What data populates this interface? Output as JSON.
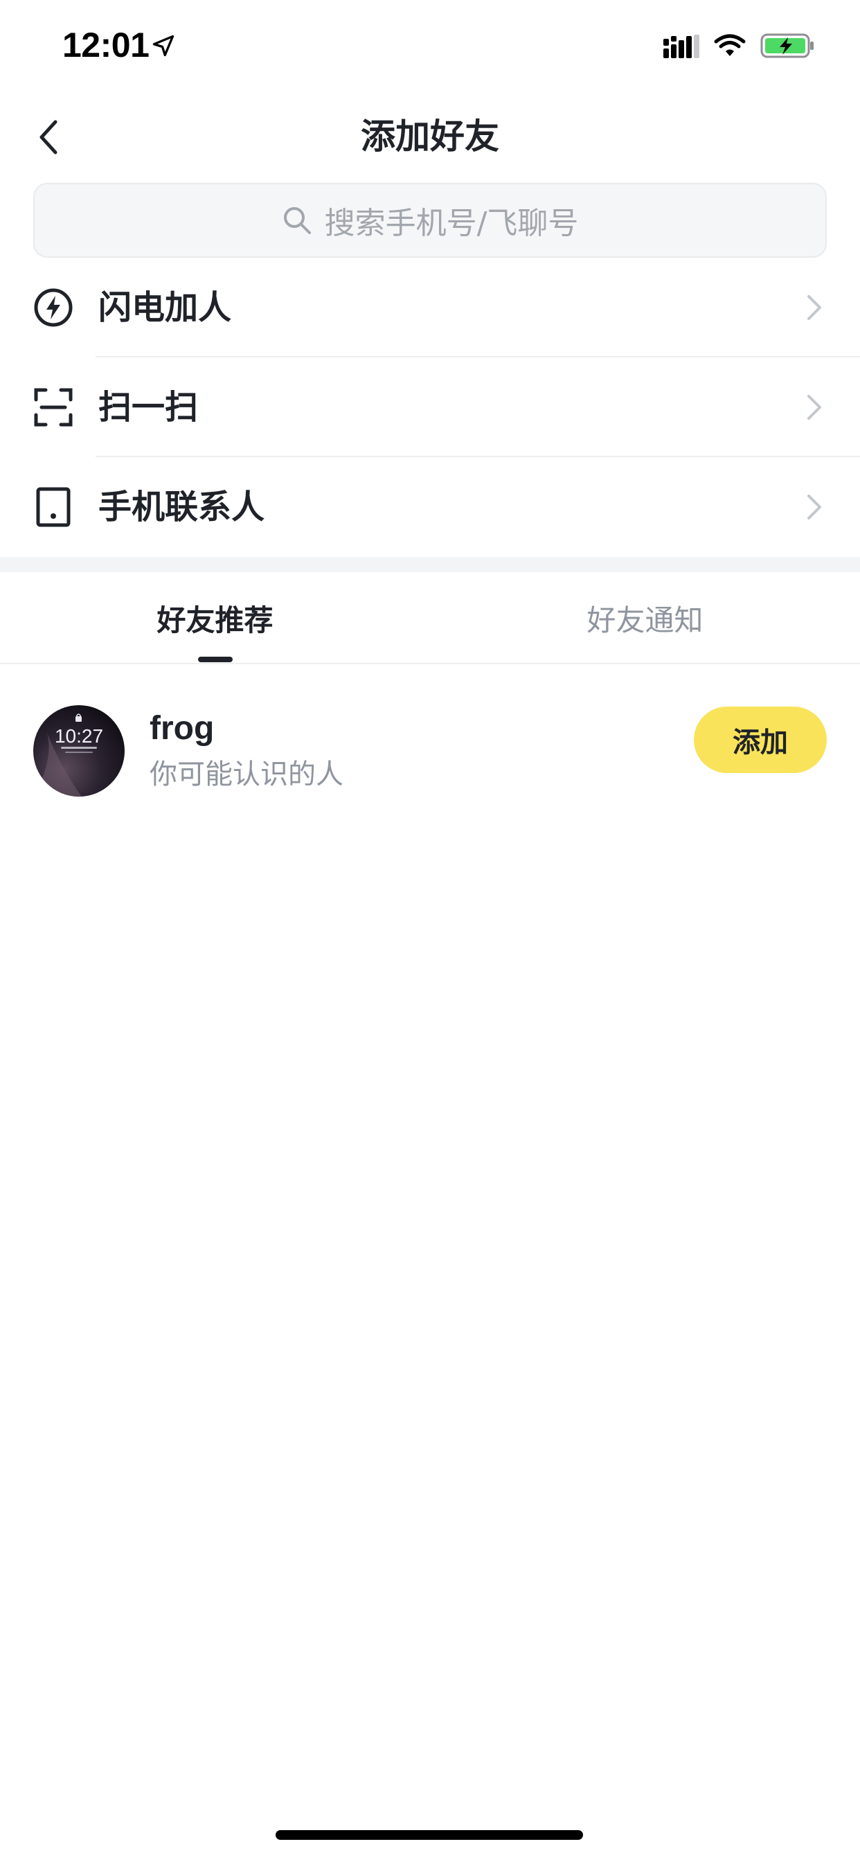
{
  "status_bar": {
    "time": "12:01",
    "icons": [
      "location-arrow-icon",
      "cellular-signal-icon",
      "wifi-icon",
      "battery-charging-icon"
    ],
    "battery_color": "#4cd964"
  },
  "nav": {
    "title": "添加好友",
    "back_icon": "chevron-left-icon"
  },
  "search": {
    "placeholder": "搜索手机号/飞聊号",
    "icon": "search-icon"
  },
  "menu": {
    "items": [
      {
        "label": "闪电加人",
        "icon": "lightning-icon"
      },
      {
        "label": "扫一扫",
        "icon": "scan-icon"
      },
      {
        "label": "手机联系人",
        "icon": "phone-contacts-icon"
      }
    ],
    "chevron_icon": "chevron-right-icon"
  },
  "tabs": {
    "items": [
      {
        "label": "好友推荐",
        "active": true
      },
      {
        "label": "好友通知",
        "active": false
      }
    ]
  },
  "recommendations": [
    {
      "name": "frog",
      "subtitle": "你可能认识的人",
      "button_label": "添加",
      "avatar_text": "10:27"
    }
  ],
  "colors": {
    "accent_button": "#f9e35a",
    "text_primary": "#1f2329",
    "text_secondary": "#8f959e",
    "search_bg": "#f5f6f7"
  }
}
